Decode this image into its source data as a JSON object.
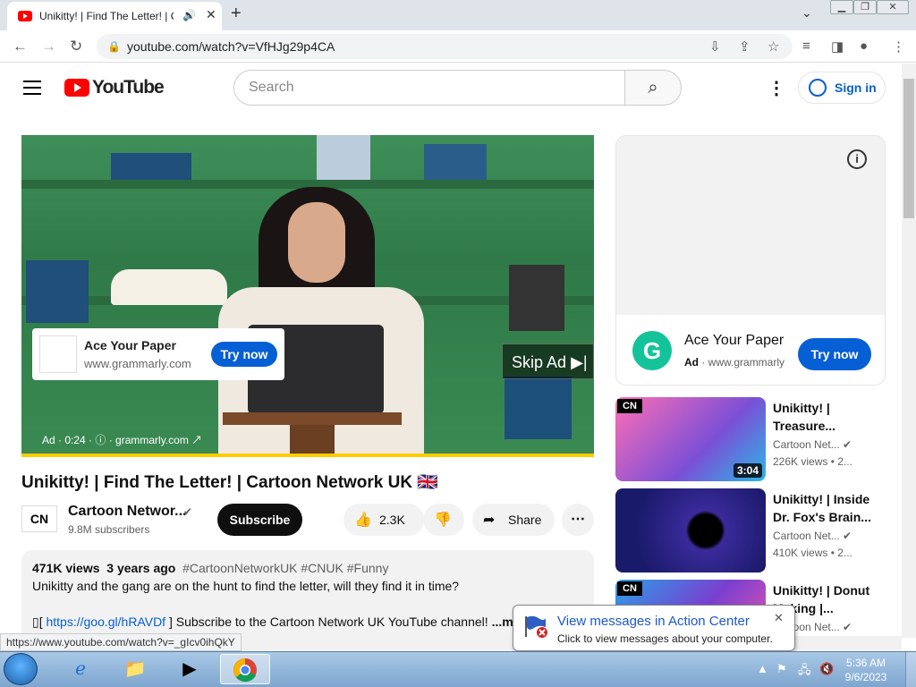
{
  "browser": {
    "tab_title": "Unikitty! | Find The Letter! | C",
    "url": "youtube.com/watch?v=VfHJg29p4CA",
    "status_url": "https://www.youtube.com/watch?v=_gIcv0ihQkY"
  },
  "header": {
    "logo_text": "YouTube",
    "search_placeholder": "Search",
    "sign_in": "Sign in"
  },
  "video_ad": {
    "title": "Ace Your Paper",
    "url": "www.grammarly.com",
    "cta": "Try now",
    "skip": "Skip Ad",
    "info": "Ad · 0:24 · ⓘ · grammarly.com ↗"
  },
  "video": {
    "title": "Unikitty! | Find The Letter! | Cartoon Network UK 🇬🇧",
    "channel": "Cartoon Networ...",
    "channel_logo": "CN",
    "subscribers": "9.8M subscribers",
    "subscribe": "Subscribe",
    "likes": "2.3K",
    "share": "Share",
    "views": "471K views",
    "age": "3 years ago",
    "tags": "#CartoonNetworkUK #CNUK #Funny",
    "description_line1": "Unikitty and the gang are on the hunt to find the letter, will they find it in time?",
    "description_link": "https://goo.gl/hRAVDf",
    "description_line2": "] Subscribe to the Cartoon Network UK YouTube channel!",
    "more": "...more"
  },
  "side_ad": {
    "title": "Ace Your Paper",
    "ad_label": "Ad",
    "url": "· www.grammarly",
    "cta": "Try now",
    "logo_letter": "G"
  },
  "recommendations": [
    {
      "title": "Unikitty! | Treasure...",
      "channel": "Cartoon Net...",
      "meta": "226K views  • 2...",
      "duration": "3:04"
    },
    {
      "title": "Unikitty! | Inside Dr. Fox's Brain...",
      "channel": "Cartoon Net...",
      "meta": "410K views  • 2...",
      "duration": ""
    },
    {
      "title": "Unikitty! | Donut Making |...",
      "channel": "Cartoon Net...",
      "meta": "",
      "duration": ""
    }
  ],
  "notification": {
    "heading": "View messages in Action Center",
    "body": "Click to view messages about your computer."
  },
  "taskbar": {
    "time": "5:36 AM",
    "date": "9/6/2023"
  },
  "colors": {
    "youtube_red": "#ff0000",
    "link_blue": "#065fd4",
    "grammarly_green": "#15c39a"
  }
}
